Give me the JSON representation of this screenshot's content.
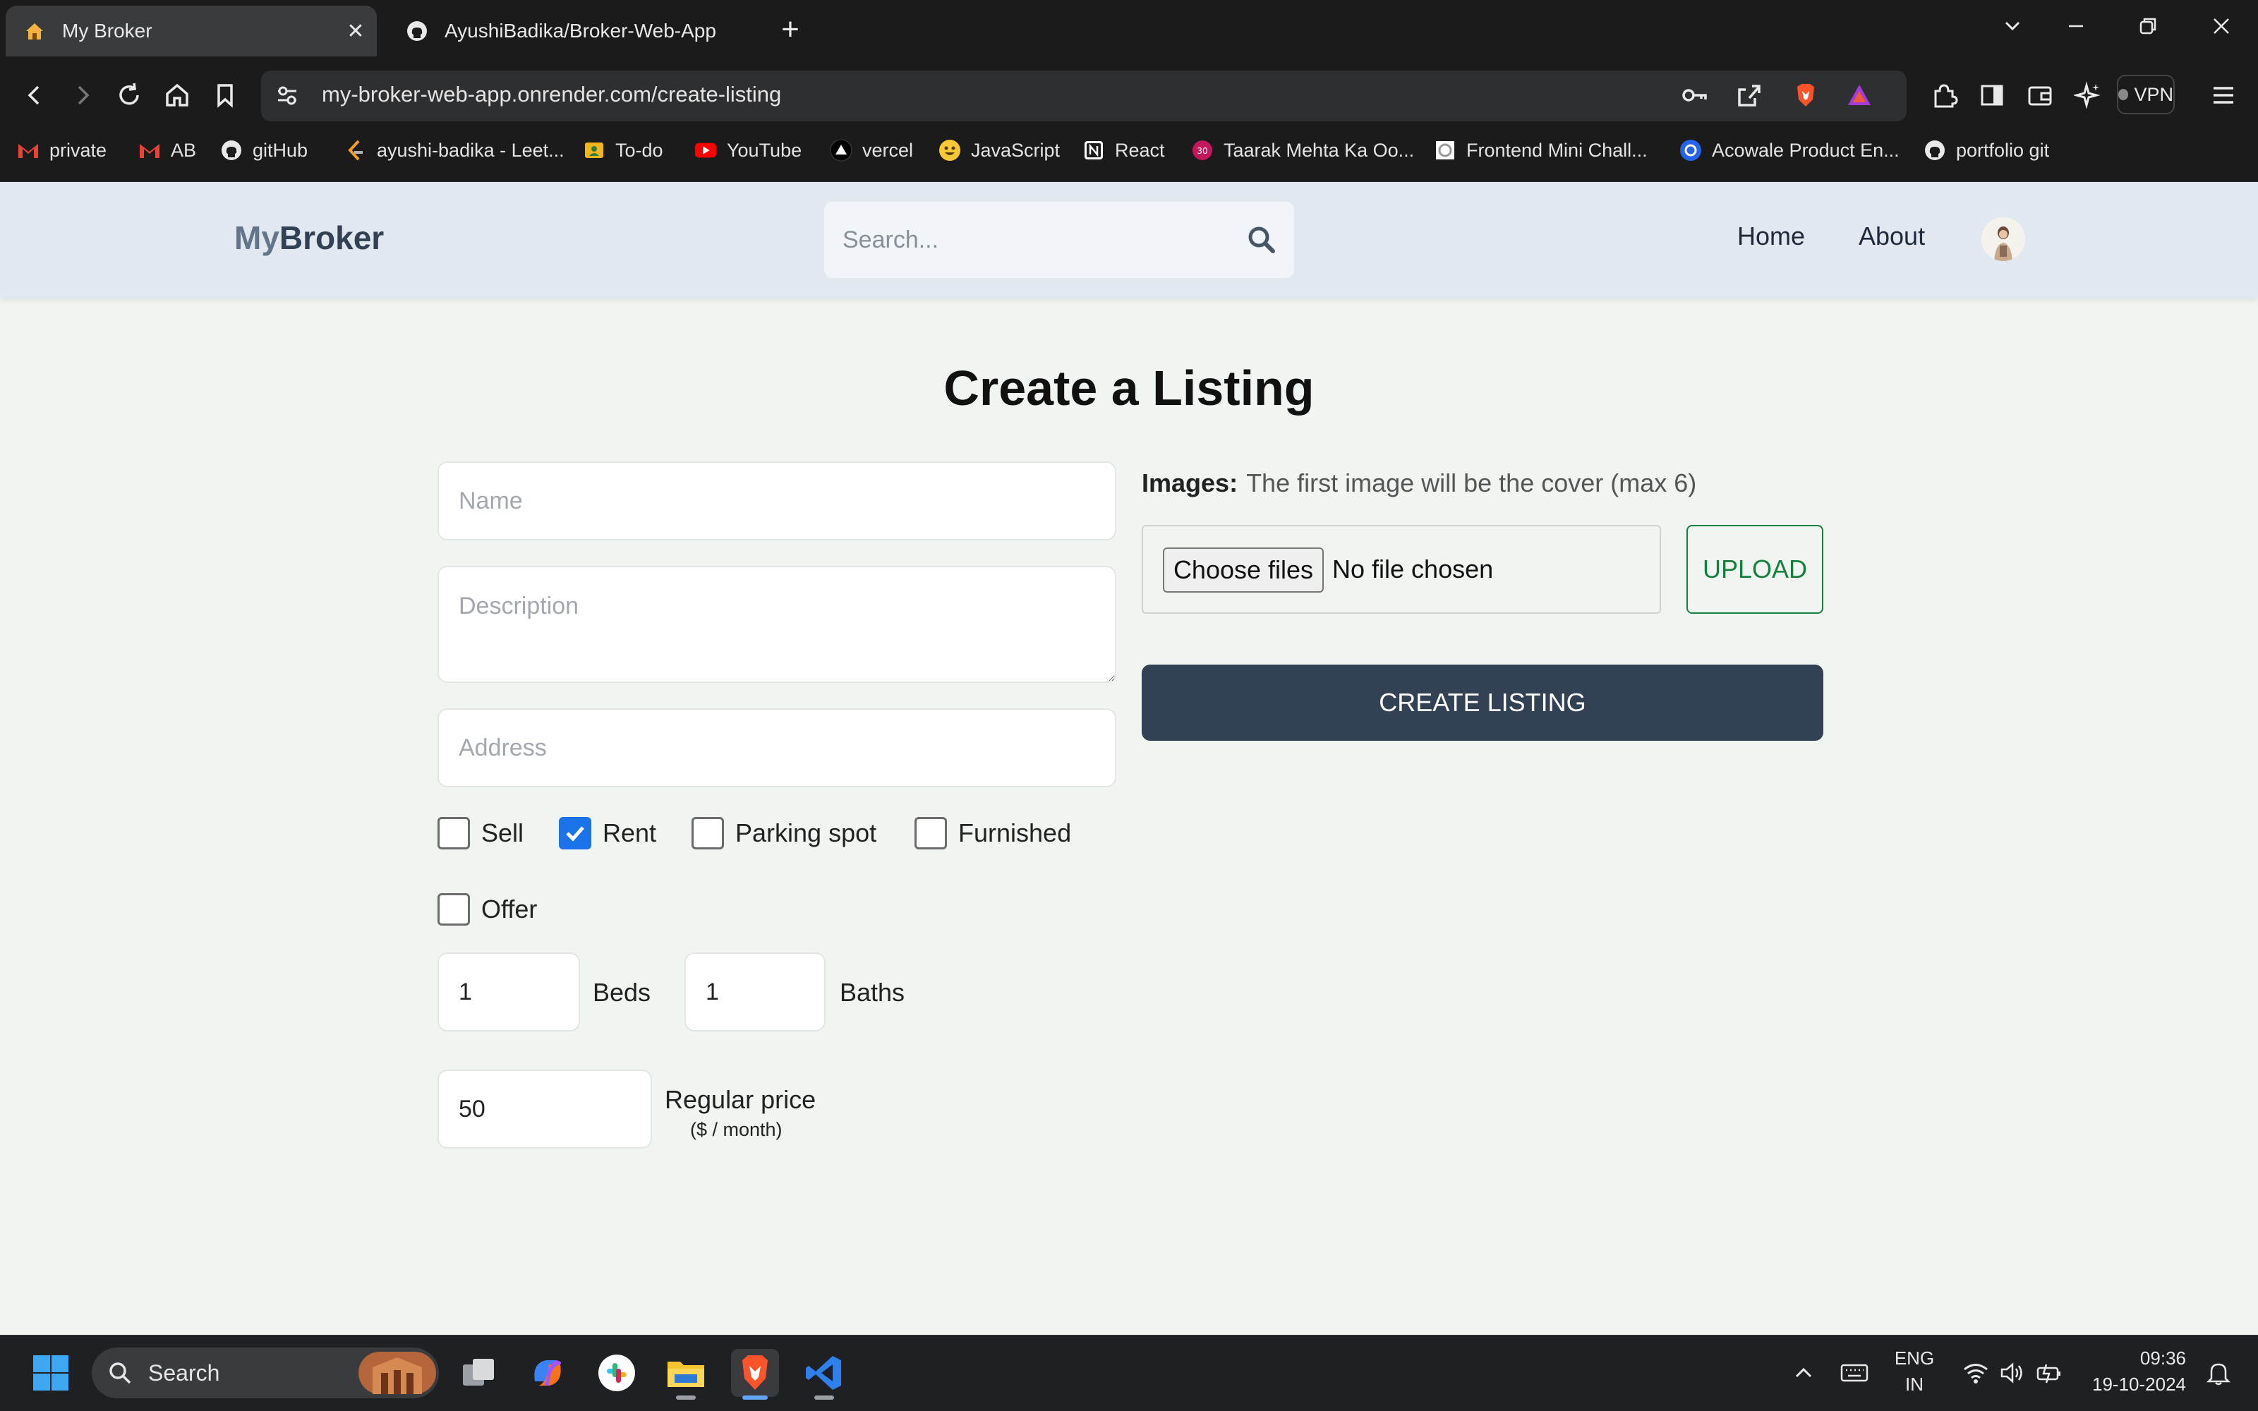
{
  "browser": {
    "tabs": [
      {
        "title": "My Broker",
        "close": "✕"
      },
      {
        "title": "AyushiBadika/Broker-Web-App"
      }
    ],
    "new_tab": "+",
    "url": "my-broker-web-app.onrender.com/create-listing",
    "vpn_label": "VPN",
    "bookmarks": [
      {
        "label": "private",
        "icon": "gmail-icon"
      },
      {
        "label": "AB",
        "icon": "gmail-icon"
      },
      {
        "label": "gitHub",
        "icon": "github-icon"
      },
      {
        "label": "ayushi-badika - Leet...",
        "icon": "leetcode-icon"
      },
      {
        "label": "To-do",
        "icon": "todo-icon"
      },
      {
        "label": "YouTube",
        "icon": "youtube-icon"
      },
      {
        "label": "vercel",
        "icon": "vercel-icon"
      },
      {
        "label": "JavaScript",
        "icon": "emoji-icon"
      },
      {
        "label": "React",
        "icon": "notion-icon"
      },
      {
        "label": "Taarak Mehta Ka Oo...",
        "icon": "tmkoc-icon"
      },
      {
        "label": "Frontend Mini Chall...",
        "icon": "frontend-icon"
      },
      {
        "label": "Acowale Product En...",
        "icon": "acowale-icon"
      },
      {
        "label": "portfolio git",
        "icon": "github-icon"
      }
    ]
  },
  "app": {
    "logo_part1": "My",
    "logo_part2": "Broker",
    "search_placeholder": "Search...",
    "nav": [
      "Home",
      "About"
    ]
  },
  "form": {
    "title": "Create a Listing",
    "name_placeholder": "Name",
    "description_placeholder": "Description",
    "address_placeholder": "Address",
    "checkboxes": [
      {
        "label": "Sell",
        "checked": false
      },
      {
        "label": "Rent",
        "checked": true
      },
      {
        "label": "Parking spot",
        "checked": false
      },
      {
        "label": "Furnished",
        "checked": false
      },
      {
        "label": "Offer",
        "checked": false
      }
    ],
    "beds_value": "1",
    "beds_label": "Beds",
    "baths_value": "1",
    "baths_label": "Baths",
    "price_value": "50",
    "price_label": "Regular price",
    "price_unit": "($ / month)",
    "images_label": "Images:",
    "images_hint": "The first image will be the cover (max 6)",
    "choose_files": "Choose files",
    "no_file": "No file chosen",
    "upload": "UPLOAD",
    "create": "CREATE LISTING"
  },
  "taskbar": {
    "search": "Search",
    "lang1": "ENG",
    "lang2": "IN",
    "time": "09:36",
    "date": "19-10-2024"
  },
  "colors": {
    "accent_dark": "#334155",
    "upload_green": "#15803d",
    "checkbox_blue": "#1a73e8",
    "page_bg": "#f1f5f1",
    "header_bg": "#e2e8f0"
  }
}
